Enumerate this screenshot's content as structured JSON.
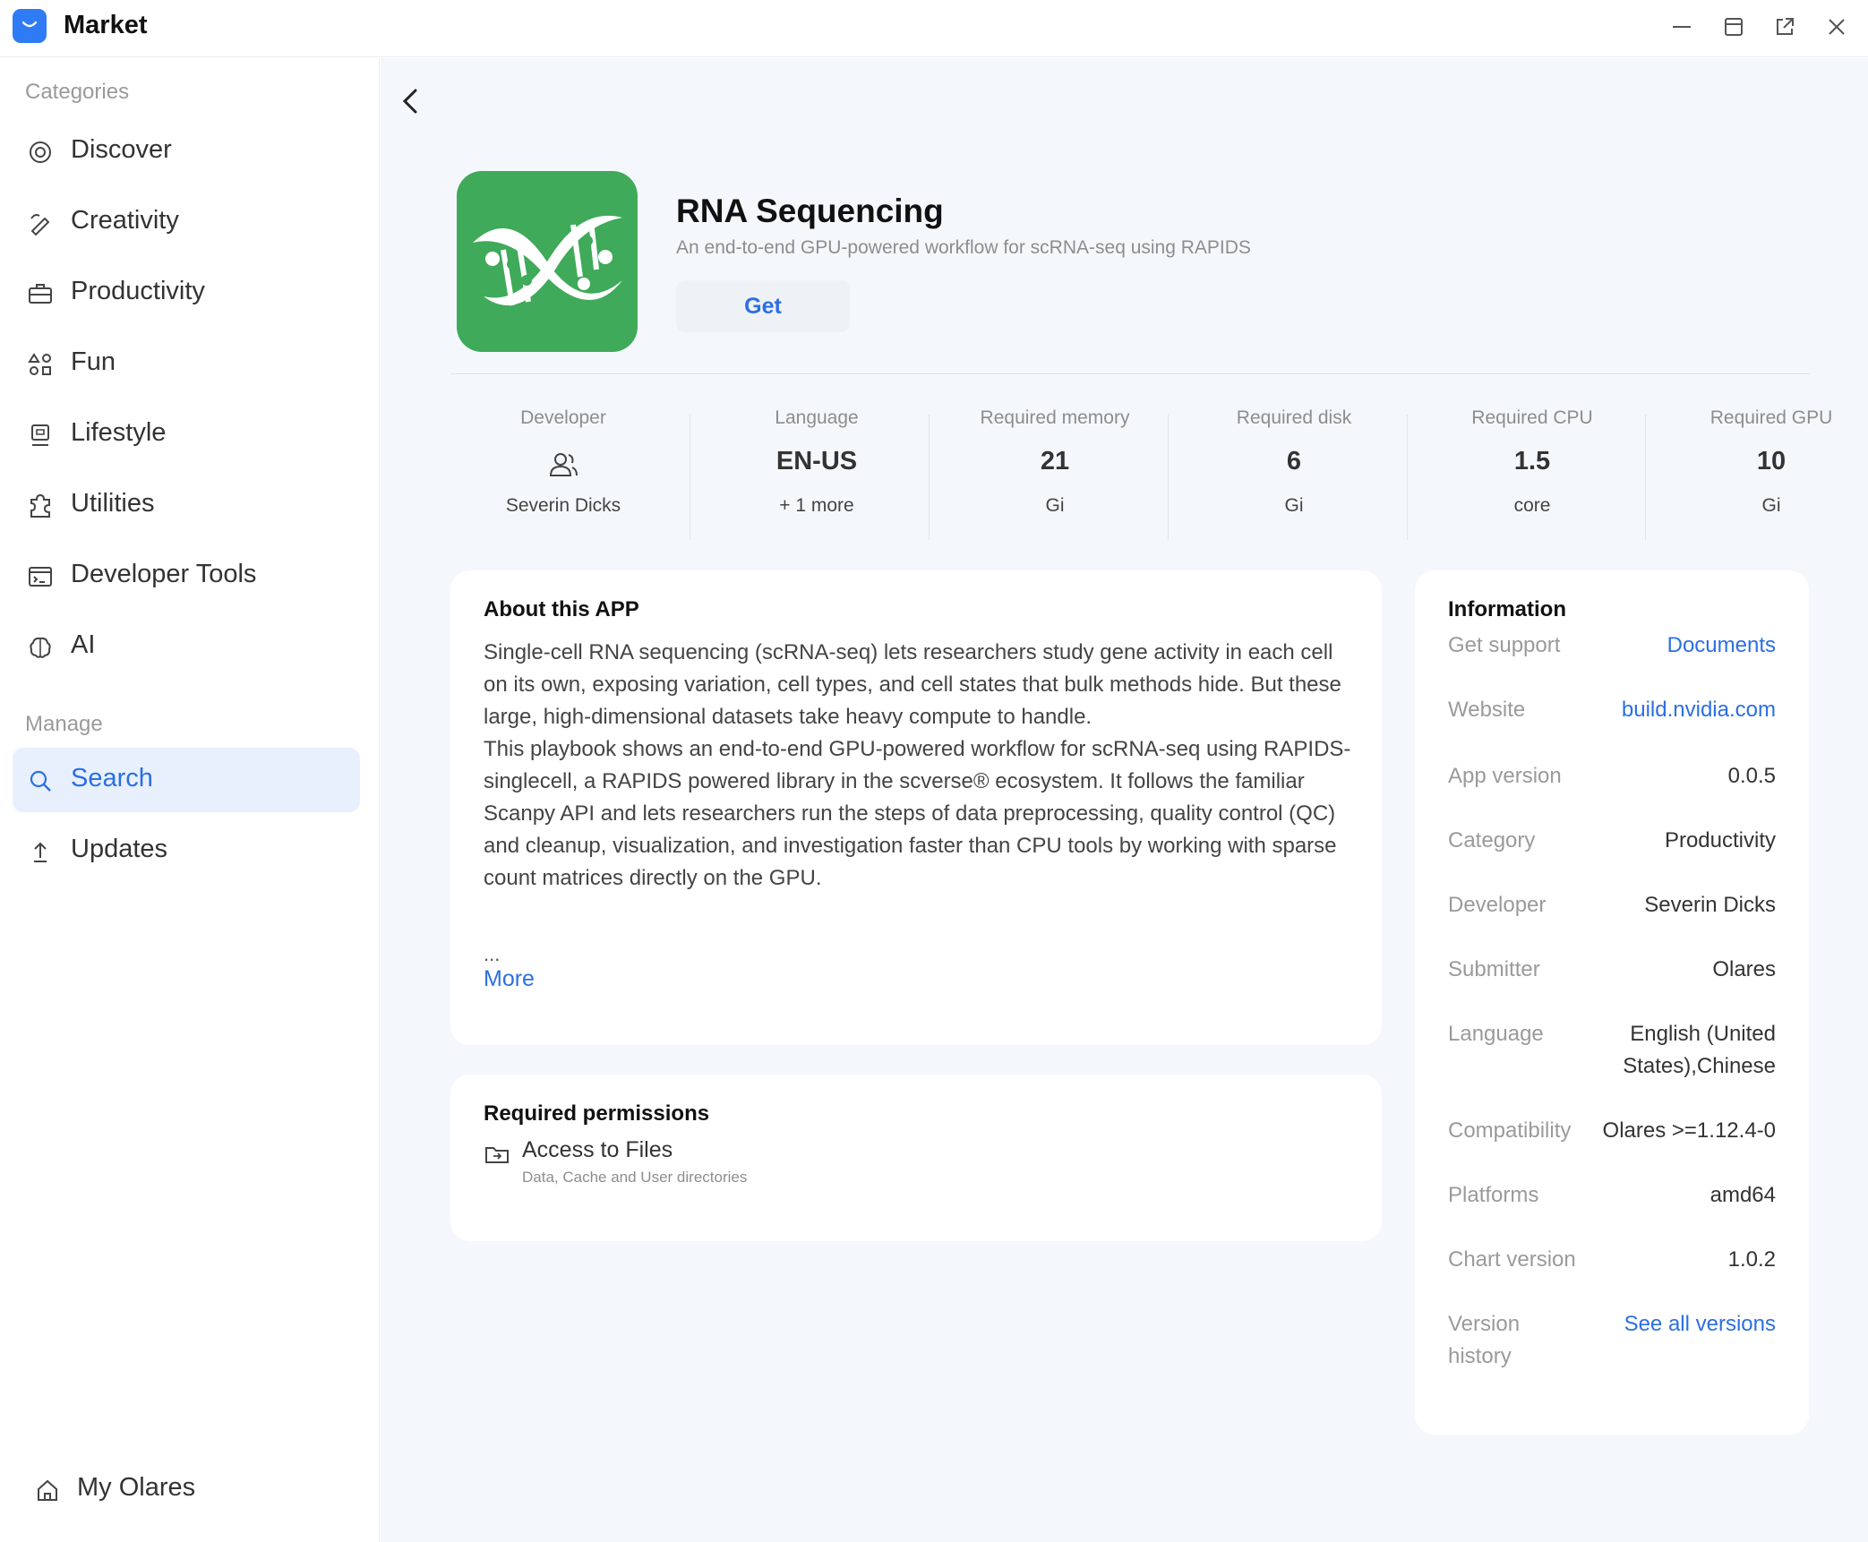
{
  "window": {
    "title": "Market",
    "controls": [
      "minimize-icon",
      "maximize-icon",
      "open-external-icon",
      "close-icon"
    ]
  },
  "sidebar": {
    "categories_label": "Categories",
    "categories": [
      {
        "label": "Discover",
        "icon": "discover-icon"
      },
      {
        "label": "Creativity",
        "icon": "creativity-icon"
      },
      {
        "label": "Productivity",
        "icon": "productivity-icon"
      },
      {
        "label": "Fun",
        "icon": "fun-icon"
      },
      {
        "label": "Lifestyle",
        "icon": "lifestyle-icon"
      },
      {
        "label": "Utilities",
        "icon": "utilities-icon"
      },
      {
        "label": "Developer Tools",
        "icon": "developer-tools-icon"
      },
      {
        "label": "AI",
        "icon": "ai-icon"
      }
    ],
    "manage_label": "Manage",
    "manage": [
      {
        "label": "Search",
        "icon": "search-icon",
        "active": true
      },
      {
        "label": "Updates",
        "icon": "updates-icon",
        "active": false
      }
    ],
    "bottom": {
      "label": "My Olares",
      "icon": "home-icon"
    }
  },
  "app": {
    "name": "RNA Sequencing",
    "subtitle": "An end-to-end GPU-powered workflow for scRNA-seq using RAPIDS",
    "get_label": "Get",
    "icon_color": "#3faa5a"
  },
  "stats": {
    "developer": {
      "label": "Developer",
      "value": "Severin Dicks"
    },
    "language": {
      "label": "Language",
      "value": "EN-US",
      "unit": "+ 1 more"
    },
    "memory": {
      "label": "Required memory",
      "value": "21",
      "unit": "Gi"
    },
    "disk": {
      "label": "Required disk",
      "value": "6",
      "unit": "Gi"
    },
    "cpu": {
      "label": "Required CPU",
      "value": "1.5",
      "unit": "core"
    },
    "gpu": {
      "label": "Required GPU",
      "value": "10",
      "unit": "Gi"
    }
  },
  "about": {
    "title": "About this APP",
    "p1": "Single-cell RNA sequencing (scRNA-seq) lets researchers study gene activity in each cell on its own, exposing variation, cell types, and cell states that bulk methods hide. But these large, high-dimensional datasets take heavy compute to handle.",
    "p2": "This playbook shows an end-to-end GPU-powered workflow for scRNA-seq using RAPIDS-singlecell, a RAPIDS powered library in the scverse® ecosystem. It follows the familiar Scanpy API and lets researchers run the steps of data preprocessing, quality control (QC) and cleanup, visualization, and investigation faster than CPU tools by working with sparse count matrices directly on the GPU.",
    "ellipsis": "...",
    "more": "More"
  },
  "permissions": {
    "title": "Required permissions",
    "items": [
      {
        "name": "Access to Files",
        "desc": "Data, Cache and User directories",
        "icon": "folder-icon"
      }
    ]
  },
  "information": {
    "title": "Information",
    "rows": [
      {
        "key": "Get support",
        "value": "Documents",
        "link": true
      },
      {
        "key": "Website",
        "value": "build.nvidia.com",
        "link": true
      },
      {
        "key": "App version",
        "value": "0.0.5",
        "link": false
      },
      {
        "key": "Category",
        "value": "Productivity",
        "link": false
      },
      {
        "key": "Developer",
        "value": "Severin Dicks",
        "link": false
      },
      {
        "key": "Submitter",
        "value": "Olares",
        "link": false
      },
      {
        "key": "Language",
        "value": "English (United States),Chinese",
        "link": false
      },
      {
        "key": "Compatibility",
        "value": "Olares >=1.12.4-0",
        "link": false
      },
      {
        "key": "Platforms",
        "value": "amd64",
        "link": false
      },
      {
        "key": "Chart version",
        "value": "1.0.2",
        "link": false
      },
      {
        "key": "Version history",
        "value": "See all versions",
        "link": true
      }
    ]
  },
  "colors": {
    "accent": "#2b6fe2",
    "active_bg": "#e8f0fd",
    "main_bg": "#f4f8fd"
  }
}
